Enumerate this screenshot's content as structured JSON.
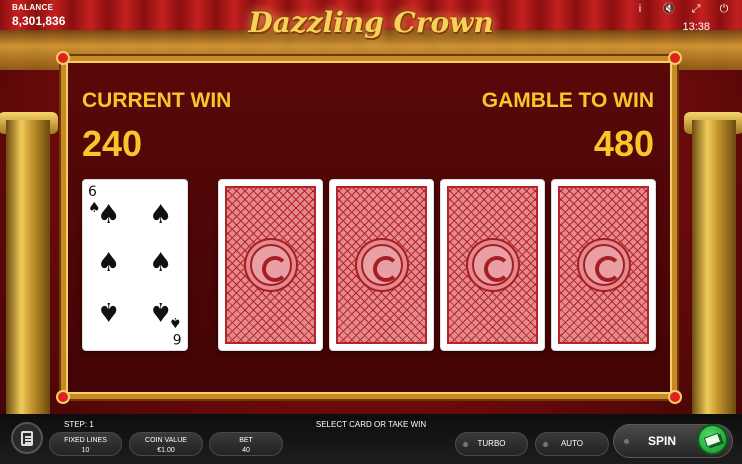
{
  "header": {
    "balance_label": "BALANCE",
    "balance_value": "8,301,836",
    "game_title": "Dazzling Crown",
    "icons": [
      "info-icon",
      "sound-muted-icon",
      "fullscreen-icon",
      "power-icon"
    ],
    "time": "13:38"
  },
  "gamble": {
    "current_win_label": "CURRENT WIN",
    "current_win_value": "240",
    "gamble_to_win_label": "GAMBLE TO WIN",
    "gamble_to_win_value": "480",
    "dealer_card": {
      "rank": "6",
      "suit": "spades",
      "suit_symbol": "♠"
    },
    "face_down_cards": 4
  },
  "bottom_bar": {
    "step_label": "STEP: 1",
    "status_message": "SELECT CARD OR TAKE WIN",
    "fixed_lines": {
      "label": "FIXED LINES",
      "value": "10"
    },
    "coin_value": {
      "label": "COIN VALUE",
      "value": "€1.00"
    },
    "bet": {
      "label": "BET",
      "value": "40"
    },
    "turbo_label": "TURBO",
    "auto_label": "AUTO",
    "spin_label": "SPIN"
  },
  "colors": {
    "accent_gold": "#f6c72b",
    "card_back_red": "#b7252a",
    "collect_green": "#15902b"
  }
}
